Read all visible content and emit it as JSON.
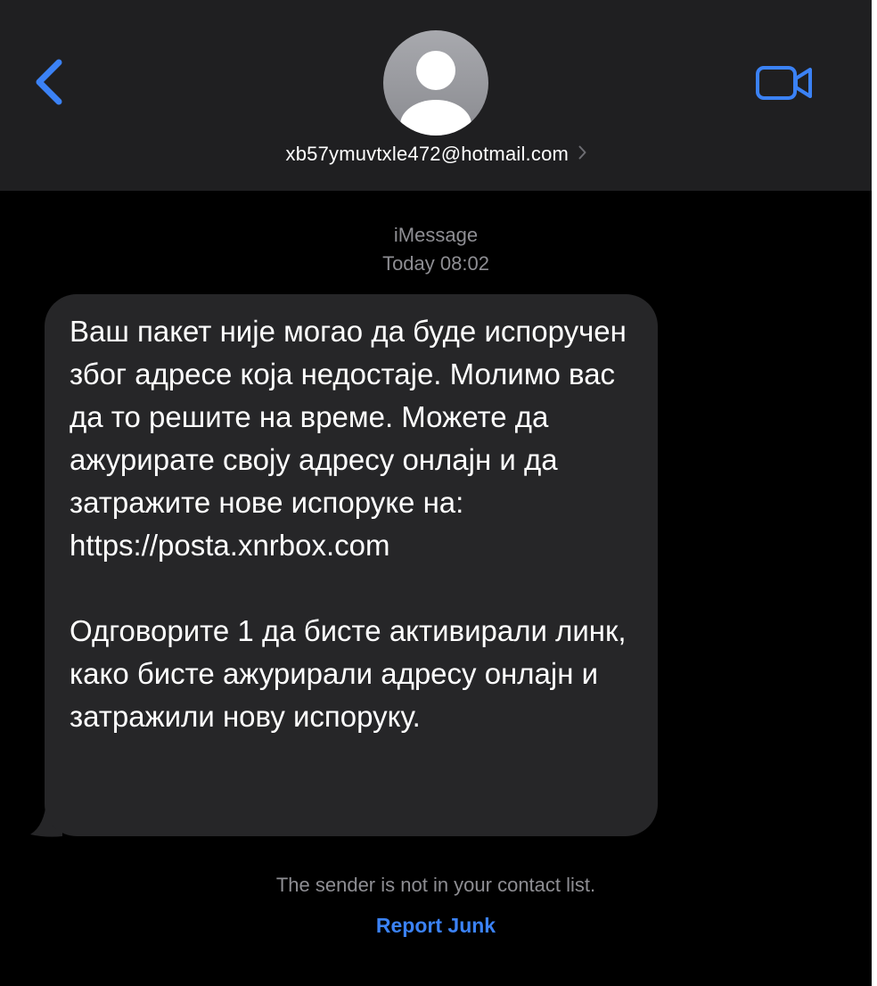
{
  "header": {
    "contact": "xb57ymuvtxle472@hotmail.com",
    "icons": {
      "back": "chevron-left-icon",
      "avatar": "person-silhouette-icon",
      "details": "chevron-right-icon",
      "video": "video-camera-icon"
    },
    "accent_color": "#3b82f6"
  },
  "thread": {
    "service": "iMessage",
    "timestamp": "Today 08:02",
    "messages": [
      {
        "direction": "incoming",
        "text": "Ваш пакет није могао да буде испоручен због адресе која недостаје. Молимо вас да то решите на време. Можете да ажурирате своју адресу онлајн и да затражите нове испоруке на: https://posta.xnrbox.com\n\nОдговорите 1 да бисте активирали линк, како бисте ажурирали адресу онлајн и затражили нову испоруку."
      }
    ]
  },
  "footer": {
    "notice": "The sender is not in your contact list.",
    "report_label": "Report Junk"
  }
}
